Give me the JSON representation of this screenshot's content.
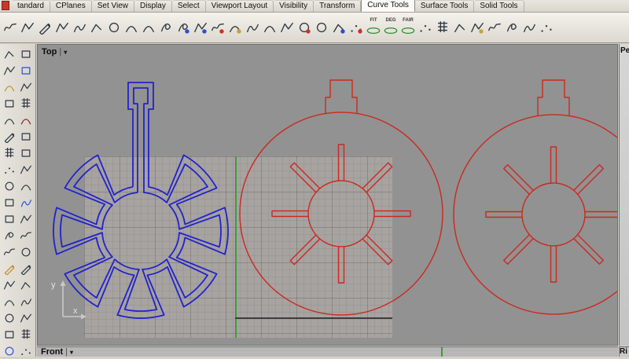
{
  "tab_bar": {
    "tabs": [
      {
        "label": "tandard",
        "active": false
      },
      {
        "label": "CPlanes",
        "active": false
      },
      {
        "label": "Set View",
        "active": false
      },
      {
        "label": "Display",
        "active": false
      },
      {
        "label": "Select",
        "active": false
      },
      {
        "label": "Viewport Layout",
        "active": false
      },
      {
        "label": "Visibility",
        "active": false
      },
      {
        "label": "Transform",
        "active": false
      },
      {
        "label": "Curve Tools",
        "active": true
      },
      {
        "label": "Surface Tools",
        "active": false
      },
      {
        "label": "Solid Tools",
        "active": false
      }
    ]
  },
  "toolbar": {
    "icons": [
      {
        "name": "adjust-curve-seam",
        "variant": "wave"
      },
      {
        "name": "curve-from-two-views",
        "variant": "poly"
      },
      {
        "name": "sketch-curve",
        "variant": "pen"
      },
      {
        "name": "polyline",
        "variant": "poly"
      },
      {
        "name": "interpolate-curve",
        "variant": "snake"
      },
      {
        "name": "control-point-curve",
        "variant": "pts"
      },
      {
        "name": "circle-center-radius",
        "variant": "circle"
      },
      {
        "name": "arc-center-angle",
        "variant": "arc"
      },
      {
        "name": "conic",
        "variant": "arc"
      },
      {
        "name": "helix",
        "variant": "loop"
      },
      {
        "name": "spiral",
        "variant": "loop",
        "accent": "#2b4fd4"
      },
      {
        "name": "extend-curve",
        "variant": "poly",
        "accent": "#2b4fd4"
      },
      {
        "name": "continue-curve",
        "variant": "wave",
        "accent": "#d03020"
      },
      {
        "name": "blend-curve",
        "variant": "arc",
        "accent": "#caa23a"
      },
      {
        "name": "offset-curve",
        "variant": "snake"
      },
      {
        "name": "fillet-curves",
        "variant": "arc"
      },
      {
        "name": "chamfer-curves",
        "variant": "poly"
      },
      {
        "name": "curve-boolean",
        "variant": "circle",
        "accent": "#d03020"
      },
      {
        "name": "curvature-circle",
        "variant": "circle"
      },
      {
        "name": "curvature-graph",
        "variant": "pts",
        "accent": "#2b4fd4"
      },
      {
        "name": "point-deviation",
        "variant": "dots",
        "accent": "#d03020"
      },
      {
        "name": "fit-curve",
        "badge": "FIT"
      },
      {
        "name": "change-degree",
        "badge": "DEG"
      },
      {
        "name": "fair-curve",
        "badge": "FAIR"
      },
      {
        "name": "rebuild-curve",
        "variant": "dots"
      },
      {
        "name": "insert-knot",
        "variant": "grid"
      },
      {
        "name": "insert-kink",
        "variant": "pts"
      },
      {
        "name": "handlebar-editor",
        "variant": "poly",
        "accent": "#caa23a"
      },
      {
        "name": "match-curve",
        "variant": "wave"
      },
      {
        "name": "symmetry",
        "variant": "loop"
      },
      {
        "name": "smooth",
        "variant": "snake"
      },
      {
        "name": "sort-points",
        "variant": "dots"
      }
    ]
  },
  "sidebar": {
    "icons": [
      {
        "name": "select-objects",
        "variant": "pts"
      },
      {
        "name": "select-window",
        "variant": "rect"
      },
      {
        "name": "move",
        "variant": "poly"
      },
      {
        "name": "copy",
        "variant": "rect",
        "stroke": "#2b4fd4"
      },
      {
        "name": "rotate",
        "variant": "arc",
        "stroke": "#c09020"
      },
      {
        "name": "scale",
        "variant": "poly"
      },
      {
        "name": "mirror",
        "variant": "rect"
      },
      {
        "name": "array",
        "variant": "grid"
      },
      {
        "name": "undo",
        "variant": "arc"
      },
      {
        "name": "redo",
        "variant": "arc",
        "stroke": "#8a2020"
      },
      {
        "name": "cut",
        "variant": "pen"
      },
      {
        "name": "paste",
        "variant": "rect"
      },
      {
        "name": "layers",
        "variant": "grid"
      },
      {
        "name": "properties",
        "variant": "rect"
      },
      {
        "name": "point",
        "variant": "dots"
      },
      {
        "name": "polyline-tool",
        "variant": "poly"
      },
      {
        "name": "circle-tool",
        "variant": "circle"
      },
      {
        "name": "arc-tool",
        "variant": "arc"
      },
      {
        "name": "rectangle-tool",
        "variant": "rect"
      },
      {
        "name": "curve-tool",
        "variant": "snake",
        "stroke": "#2b4fd4"
      },
      {
        "name": "surface-tool",
        "variant": "rect"
      },
      {
        "name": "extrude",
        "variant": "poly"
      },
      {
        "name": "revolve",
        "variant": "loop"
      },
      {
        "name": "sweep",
        "variant": "wave"
      },
      {
        "name": "loft",
        "variant": "wave"
      },
      {
        "name": "boolean-union",
        "variant": "circle"
      },
      {
        "name": "trim",
        "variant": "pen",
        "stroke": "#c09020"
      },
      {
        "name": "split",
        "variant": "pen"
      },
      {
        "name": "join",
        "variant": "poly"
      },
      {
        "name": "explode",
        "variant": "pts"
      },
      {
        "name": "fillet",
        "variant": "arc"
      },
      {
        "name": "offset",
        "variant": "snake"
      },
      {
        "name": "zoom-extents",
        "variant": "circle"
      },
      {
        "name": "pan-view",
        "variant": "poly"
      },
      {
        "name": "shaded-view",
        "variant": "rect"
      },
      {
        "name": "wireframe-view",
        "variant": "grid"
      },
      {
        "name": "render-view",
        "variant": "circle",
        "stroke": "#2b4fd4"
      },
      {
        "name": "osnap",
        "variant": "dots"
      }
    ]
  },
  "viewports": {
    "top": {
      "title": "Top"
    },
    "front": {
      "title": "Front"
    },
    "perspective": {
      "title_clipped": "Pe"
    },
    "right": {
      "title_clipped": "Ri"
    }
  },
  "axis": {
    "x_label": "x",
    "y_label": "y"
  },
  "icons": {
    "dropdown": "▾",
    "divider": "|"
  },
  "colors": {
    "blue_curve": "#2222cc",
    "red_curve": "#cc2820",
    "green_axis": "#3f9b3f",
    "dark_axis": "#3f3b3b"
  }
}
